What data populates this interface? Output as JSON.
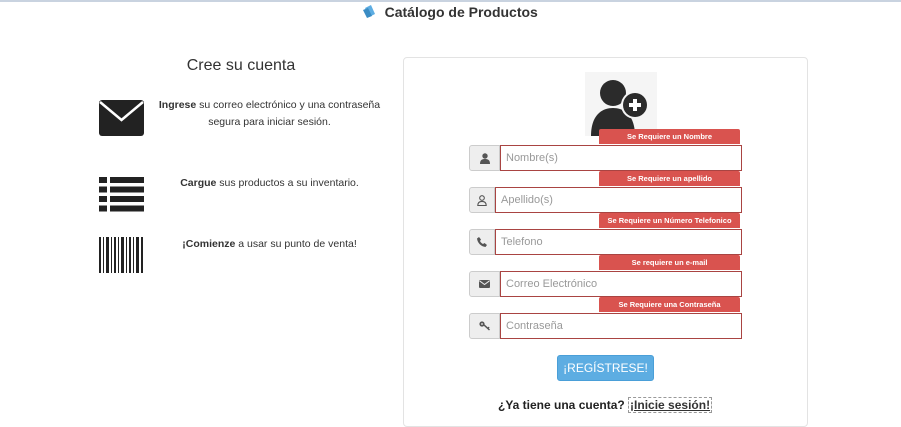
{
  "header": {
    "title": "Catálogo de Productos"
  },
  "left": {
    "title": "Cree su cuenta",
    "features": [
      {
        "icon": "envelope-icon",
        "bold": "Ingrese",
        "text": " su correo electrónico y una contraseña segura para iniciar sesión."
      },
      {
        "icon": "list-icon",
        "bold": "Cargue",
        "text": " sus productos a su inventario."
      },
      {
        "icon": "barcode-icon",
        "bold": "¡Comienze",
        "text": " a usar su punto de venta!"
      }
    ]
  },
  "form": {
    "errors": {
      "nombre": "Se Requiere un Nombre",
      "apellido": "Se Requiere un apellido",
      "telefono": "Se Requiere un Número Telefonico",
      "email": "Se requiere un e-mail",
      "password": "Se Requiere una Contraseña"
    },
    "placeholders": {
      "nombre": "Nombre(s)",
      "apellido": "Apellido(s)",
      "telefono": "Telefono",
      "email": "Correo Electrónico",
      "password": "Contraseña"
    },
    "submit_label": "¡REGÍSTRESE!",
    "login_prompt": "¿Ya tiene una cuenta?",
    "login_link": "¡Inicie sesión!"
  }
}
